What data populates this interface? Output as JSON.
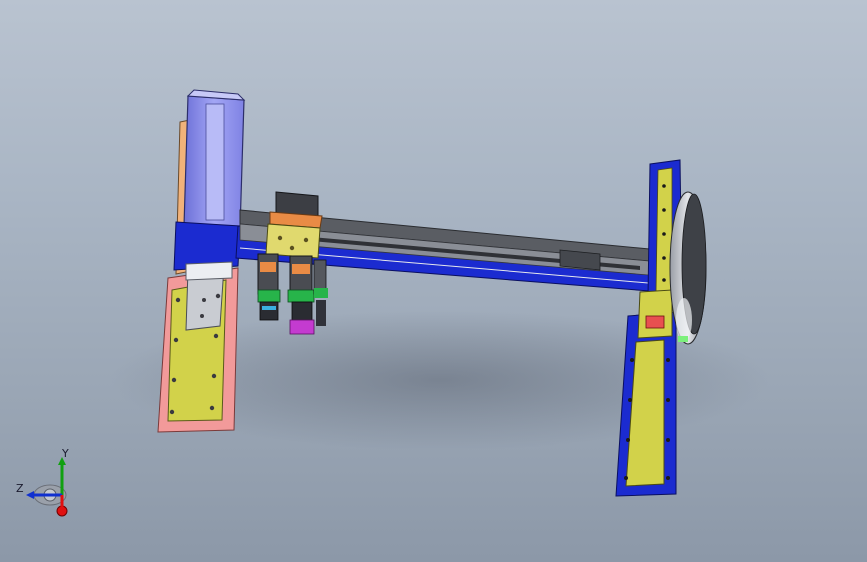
{
  "window": {
    "title": ""
  },
  "colors": {
    "viewport_top": "#b9c3d0",
    "viewport_bottom": "#8c98a8",
    "frame_blue": "#1b2bd0",
    "plate_yellow": "#d2d24a",
    "plate_pink": "#f29a9a",
    "motor_lavender": "#8f93f0",
    "rail_gray": "#6c6f76",
    "axis_x": "#e01010",
    "axis_y": "#10a010",
    "axis_z": "#1030d0"
  },
  "triad": {
    "y_label": "Y",
    "z_label": "Z"
  },
  "model": {
    "parts": [
      "left-axis-module",
      "gantry-beam",
      "gripper-head",
      "right-axis-module",
      "drive-disc"
    ]
  }
}
